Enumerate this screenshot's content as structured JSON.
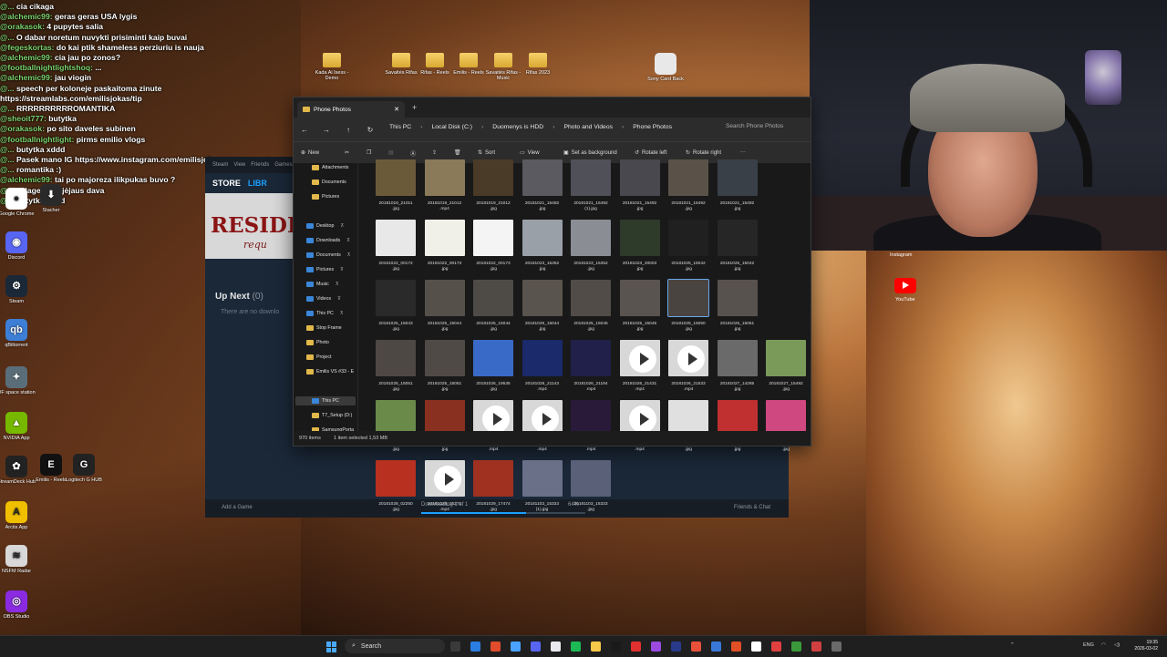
{
  "chat": [
    {
      "user": "@... ",
      "text": "cia cikaga"
    },
    {
      "user": "@alchemic99:",
      "text": "geras geras USA lygis"
    },
    {
      "user": "@orakasok:",
      "text": "4 pupytes salia"
    },
    {
      "user": "@...",
      "text": "O dabar noretum nuvykti prisiminti kaip buvai"
    },
    {
      "user": "@fegeskortas:",
      "text": "do kai ptik shameless perziuriu is nauja"
    },
    {
      "user": "@alchemic99:",
      "text": "cia jau po zonos?"
    },
    {
      "user": "@footballnightlightshoq:",
      "text": "..."
    },
    {
      "user": "@alchemic99:",
      "text": "jau viogin"
    },
    {
      "user": "@...",
      "text": "speech per koloneje paskaitoma zinute"
    },
    {
      "user": "",
      "text": "https://streamlabs.com/emilisjokas/tip"
    },
    {
      "user": "@...",
      "text": "RRRRRRRRRROMANTIKA"
    },
    {
      "user": "@sheoit777:",
      "text": "butytka"
    },
    {
      "user": "@orakasok:",
      "text": "po sito daveles subinen"
    },
    {
      "user": "@footballnightlight:",
      "text": "pirms emilio vlogs"
    },
    {
      "user": "@...",
      "text": "butytka xddd"
    },
    {
      "user": "@...",
      "text": "Pasek mano IG https://www.instagram.com/emilisjok"
    },
    {
      "user": "@...",
      "text": "romantika :)"
    },
    {
      "user": "@alchemic99:",
      "text": "tai po majoreza ilikpukas buvo ?"
    },
    {
      "user": "@...",
      "text": "is lagerio pajėjaus dava"
    },
    {
      "user": "@...",
      "text": "butytka xddd"
    }
  ],
  "desktop_top_icons": [
    "Kada Ai Isess - Demo",
    "Savaitės Rifas",
    "Rifas - Reels",
    "Emilis - Reels",
    "Savaitės Rifas - Music",
    "Rifas 2023"
  ],
  "desktop_right_icon": "Sony Card Back",
  "desktop_left_icons": [
    {
      "label": "Google Chrome",
      "color": "#ffffff",
      "glyph": "●"
    },
    {
      "label": "Discord",
      "color": "#5865f2",
      "glyph": "◉"
    },
    {
      "label": "Steam",
      "color": "#1b2838",
      "glyph": "⚙"
    },
    {
      "label": "qBittorrent",
      "color": "#3d7fd6",
      "glyph": "qb"
    },
    {
      "label": "DF space station",
      "color": "#5a6e7a",
      "glyph": "✦"
    },
    {
      "label": "NVIDIA App",
      "color": "#76b900",
      "glyph": "▲"
    },
    {
      "label": "StreamDeck Hub",
      "color": "#222222",
      "glyph": "✿"
    },
    {
      "label": "Arctis App",
      "color": "#f0c000",
      "glyph": "A"
    },
    {
      "label": "NSFM Radar",
      "color": "#d8d8d8",
      "glyph": "≋"
    },
    {
      "label": "OBS Studio",
      "color": "#8a2be2",
      "glyph": "◎"
    }
  ],
  "desktop_mid_icons": [
    {
      "label": "Stacher",
      "color": "#2a2a2a",
      "glyph": "⬇"
    },
    {
      "label": "Emilis - Reels",
      "color": "#111111",
      "glyph": "E"
    },
    {
      "label": "Logitech G HUB",
      "color": "#222222",
      "glyph": "G"
    }
  ],
  "right_desktop": {
    "instagram": "Instagram",
    "youtube": "YouTube"
  },
  "steam": {
    "menu": [
      "Steam",
      "View",
      "Friends",
      "Games"
    ],
    "nav": [
      "STORE",
      "LIBR"
    ],
    "banner_title": "RESIDEN",
    "banner_sub": "requ",
    "up_next": "Up Next",
    "up_next_count": "(0)",
    "no_downloads": "There are no downlo",
    "add_game": "Add a Game",
    "downloading": "Downloading 1 of 1",
    "progress_percent": "64%",
    "progress": 0.64,
    "friends": "Friends & Chat"
  },
  "explorer": {
    "tab_title": "Phone Photos",
    "breadcrumb": [
      "This PC",
      "Local Disk (C:)",
      "Duomenys is HDD",
      "Photo and Videos",
      "Phone Photos"
    ],
    "search_placeholder": "Search Phone Photos",
    "toolbar": {
      "new": "New",
      "sort": "Sort",
      "view": "View",
      "set_background": "Set as background",
      "rotate_left": "Rotate left",
      "rotate_right": "Rotate right",
      "more": "···"
    },
    "sidebar": [
      "Attachments",
      "Documents",
      "Pictures",
      "Desktop",
      "Downloads",
      "Documents",
      "Pictures",
      "Music",
      "Videos",
      "This PC",
      "Stop Frame",
      "Photo",
      "Project",
      "Emilis VS #33 - E",
      "This PC",
      "T7_Setup (D:)",
      "SamsungPorta"
    ],
    "status": {
      "items": "970 items",
      "selected": "1 item selected  1,53 MB"
    },
    "files": [
      {
        "name": "20181019_21011",
        "ext": ".jpg",
        "color": "#6b5a3a",
        "video": false
      },
      {
        "name": "20181019_21012",
        "ext": ".mp4",
        "color": "#8a7a5a",
        "video": false
      },
      {
        "name": "20181019_21012",
        "ext": ".jpg",
        "color": "#4a3a28",
        "video": false
      },
      {
        "name": "20181021_15482",
        "ext": ".jpg",
        "color": "#5a5a60",
        "video": false
      },
      {
        "name": "20181021_15492",
        "ext": "(1).jpg",
        "color": "#505058",
        "video": false
      },
      {
        "name": "20181021_15492",
        "ext": ".jpg",
        "color": "#48484e",
        "video": false
      },
      {
        "name": "20181021_15492",
        "ext": ".jpg",
        "color": "#5a5248",
        "video": false
      },
      {
        "name": "20181021_15492",
        "ext": ".jpg",
        "color": "#3a4048",
        "video": false
      },
      {
        "name": "20181022_00172",
        "ext": ".jpg",
        "color": "#e8e8e8",
        "video": false
      },
      {
        "name": "20181022_00173",
        "ext": ".jpg",
        "color": "#f0f0e8",
        "video": false
      },
      {
        "name": "20181022_00173",
        "ext": ".jpg",
        "color": "#f4f4f4",
        "video": false
      },
      {
        "name": "20181023_15352",
        "ext": ".jpg",
        "color": "#9aa0a8",
        "video": false
      },
      {
        "name": "20181023_15352",
        "ext": ".jpg",
        "color": "#8a8e94",
        "video": false
      },
      {
        "name": "20181023_20003",
        "ext": ".jpg",
        "color": "#2e3a2a",
        "video": false
      },
      {
        "name": "20181025_15042",
        "ext": ".jpg",
        "color": "#202020",
        "video": false
      },
      {
        "name": "20181025_15042",
        "ext": ".jpg",
        "color": "#262626",
        "video": false
      },
      {
        "name": "20181025_15043",
        "ext": ".jpg",
        "color": "#2a2a2a",
        "video": false
      },
      {
        "name": "20181025_15044",
        "ext": ".jpg",
        "color": "#55504a",
        "video": false
      },
      {
        "name": "20181025_15044",
        "ext": ".jpg",
        "color": "#4e4a46",
        "video": false
      },
      {
        "name": "20181025_15044",
        "ext": ".jpg",
        "color": "#5a544e",
        "video": false
      },
      {
        "name": "20181025_15045",
        "ext": ".jpg",
        "color": "#524c48",
        "video": false
      },
      {
        "name": "20181025_15045",
        "ext": ".jpg",
        "color": "#5a5450",
        "video": false
      },
      {
        "name": "20181025_15050",
        "ext": ".jpg",
        "color": "#4a4440",
        "video": false
      },
      {
        "name": "20181025_15051",
        "ext": ".jpg",
        "color": "#58524e",
        "video": false
      },
      {
        "name": "20181025_15051",
        "ext": ".jpg",
        "color": "#4e4844",
        "video": false
      },
      {
        "name": "20181025_15051",
        "ext": ".jpg",
        "color": "#504a46",
        "video": false
      },
      {
        "name": "20181026_19535",
        "ext": ".jpg",
        "color": "#3a6ac8",
        "video": false
      },
      {
        "name": "20181026_21143",
        "ext": ".mp4",
        "color": "#1a2a6a",
        "video": false
      },
      {
        "name": "20181026_21194",
        "ext": ".mp4",
        "color": "#20204a",
        "video": false
      },
      {
        "name": "20181026_21431",
        "ext": ".mp4",
        "color": "#d8d8d8",
        "video": true
      },
      {
        "name": "20181026_21533",
        "ext": ".mp4",
        "color": "#d8d8d8",
        "video": true
      },
      {
        "name": "20181027_14285",
        "ext": ".jpg",
        "color": "#6a6a6a",
        "video": false
      },
      {
        "name": "20181027_15492",
        "ext": ".jpg",
        "color": "#7a9a5a",
        "video": false
      },
      {
        "name": "20181027_15493",
        "ext": ".jpg",
        "color": "#6a8a4a",
        "video": false
      },
      {
        "name": "20181028_02051",
        "ext": ".jpg",
        "color": "#8a3020",
        "video": false
      },
      {
        "name": "20181028_02051",
        "ext": ".mp4",
        "color": "#d8d8d8",
        "video": true
      },
      {
        "name": "20181028_02052",
        "ext": ".mp4",
        "color": "#d8d8d8",
        "video": true
      },
      {
        "name": "20181028_02053",
        "ext": ".mp4",
        "color": "#2a1a3a",
        "video": false
      },
      {
        "name": "20181028_02054",
        "ext": ".mp4",
        "color": "#d8d8d8",
        "video": true
      },
      {
        "name": "20181028_02232",
        "ext": ".jpg",
        "color": "#e0e0e0",
        "video": false
      },
      {
        "name": "20181028_02243",
        "ext": ".jpg",
        "color": "#c03030",
        "video": false
      },
      {
        "name": "20181028_02244",
        "ext": ".jpg",
        "color": "#d04880",
        "video": false
      },
      {
        "name": "20181028_02250",
        "ext": ".jpg",
        "color": "#b83020",
        "video": false
      },
      {
        "name": "20181028_15271",
        "ext": ".mp4",
        "color": "#d8d8d8",
        "video": true
      },
      {
        "name": "20181029_17474",
        "ext": ".jpg",
        "color": "#a03020",
        "video": false
      },
      {
        "name": "20181103_15333",
        "ext": "(1).jpg",
        "color": "#6a7088",
        "video": false
      },
      {
        "name": "20181103_15333",
        "ext": ".jpg",
        "color": "#5a6078",
        "video": false
      }
    ]
  },
  "taskbar": {
    "search": "Search",
    "lang": "ENG",
    "time": "19:35",
    "date": "2026-03-02",
    "apps": [
      "#3a3a3a",
      "#2a7de1",
      "#e04c2c",
      "#4aa3ff",
      "#5865f2",
      "#e8eaed",
      "#1db954",
      "#f5c84a",
      "#1a1a1a",
      "#e03030",
      "#9a4ae0",
      "#2a3a8a",
      "#e8503a",
      "#3a78d8",
      "#e34f26",
      "#ffffff",
      "#e04040",
      "#3a9a3a",
      "#d04040",
      "#6a6a6a"
    ]
  }
}
